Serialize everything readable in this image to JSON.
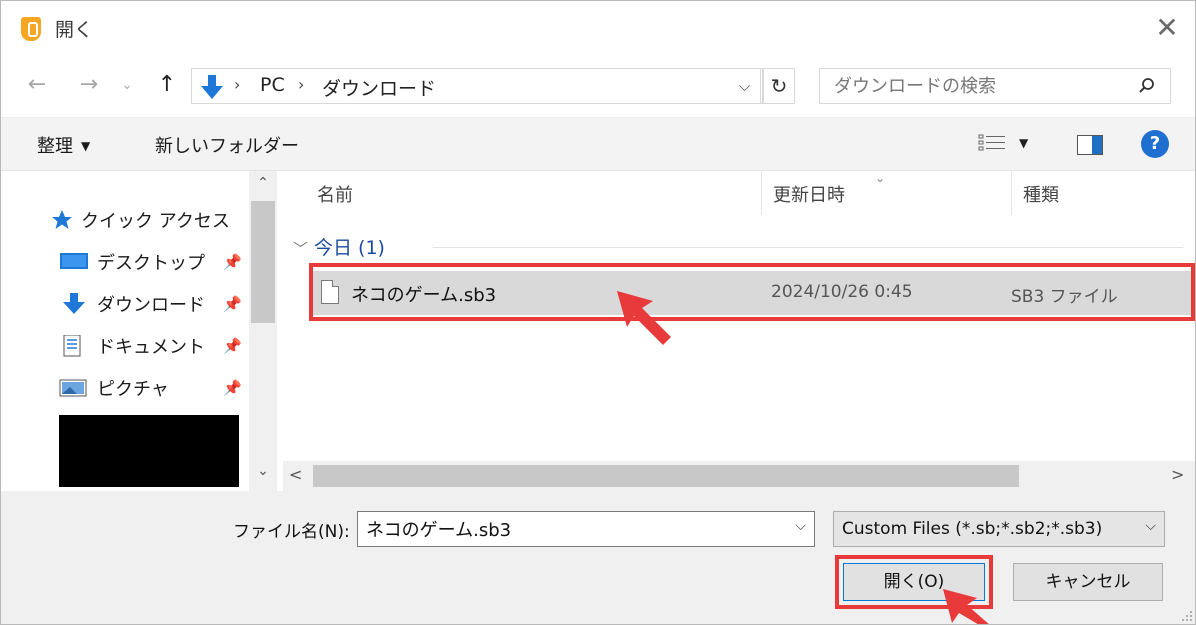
{
  "window": {
    "title": "開く",
    "accent_color": "#e83a3a",
    "selection_color": "#d9d9d9"
  },
  "nav": {
    "breadcrumbs": [
      "PC",
      "ダウンロード"
    ],
    "search_placeholder": "ダウンロードの検索"
  },
  "toolbar": {
    "organize_label": "整理",
    "new_folder_label": "新しいフォルダー"
  },
  "navpane": {
    "items": [
      {
        "label": "クイック アクセス",
        "icon": "star-icon",
        "pinned": false
      },
      {
        "label": "デスクトップ",
        "icon": "desktop-icon",
        "pinned": true
      },
      {
        "label": "ダウンロード",
        "icon": "download-icon",
        "pinned": true
      },
      {
        "label": "ドキュメント",
        "icon": "document-icon",
        "pinned": true
      },
      {
        "label": "ピクチャ",
        "icon": "pictures-icon",
        "pinned": true
      }
    ]
  },
  "filelist": {
    "columns": [
      "名前",
      "更新日時",
      "種類"
    ],
    "groups": [
      {
        "label": "今日 (1)",
        "files": [
          {
            "name": "ネコのゲーム.sb3",
            "modified": "2024/10/26 0:45",
            "type": "SB3 ファイル",
            "selected": true
          }
        ]
      }
    ]
  },
  "bottom": {
    "filename_label": "ファイル名(N):",
    "filename_value": "ネコのゲーム.sb3",
    "filter_value": "Custom Files (*.sb;*.sb2;*.sb3)",
    "open_label": "開く(O)",
    "cancel_label": "キャンセル"
  }
}
